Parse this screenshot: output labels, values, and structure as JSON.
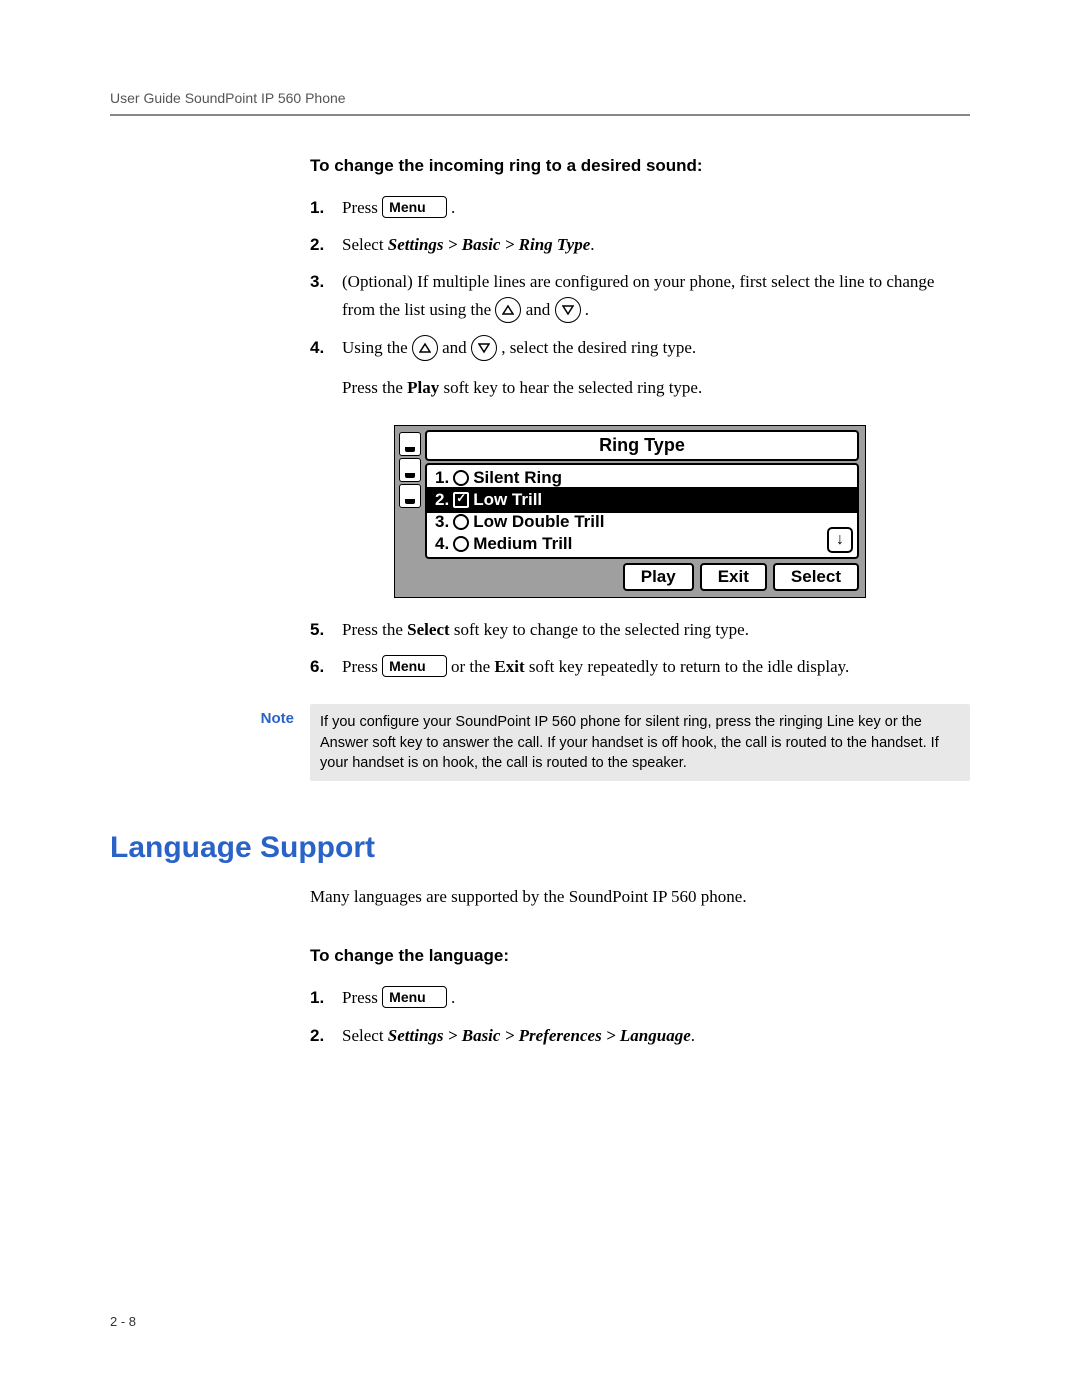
{
  "header": "User Guide SoundPoint IP 560 Phone",
  "section1": {
    "subhead": "To change the incoming ring to a desired sound:",
    "steps": {
      "s1": {
        "num": "1.",
        "press": "Press ",
        "menu": "Menu",
        "after": " ."
      },
      "s2": {
        "num": "2.",
        "select": "Select ",
        "path": "Settings > Basic > Ring Type",
        "after": "."
      },
      "s3": {
        "num": "3.",
        "t1": "(Optional) If multiple lines are configured on your phone, first select the line to change from the list using the ",
        "and": " and ",
        "after": " ."
      },
      "s4": {
        "num": "4.",
        "t1": "Using the ",
        "and": " and ",
        "t2": " , select the desired ring type.",
        "t3": "Press the ",
        "play": "Play",
        "t4": " soft key to hear the selected ring type."
      },
      "s5": {
        "num": "5.",
        "t1": "Press the ",
        "select": "Select",
        "t2": " soft key to change to the selected ring type."
      },
      "s6": {
        "num": "6.",
        "press": "Press ",
        "menu": "Menu",
        "t1": " or the ",
        "exit": "Exit",
        "t2": " soft key repeatedly to return to the idle display."
      }
    }
  },
  "screen": {
    "title": "Ring Type",
    "items": {
      "i1": {
        "num": "1.",
        "label": "Silent Ring",
        "selected": false
      },
      "i2": {
        "num": "2.",
        "label": "Low Trill",
        "selected": true
      },
      "i3": {
        "num": "3.",
        "label": "Low Double Trill",
        "selected": false
      },
      "i4": {
        "num": "4.",
        "label": "Medium Trill",
        "selected": false
      }
    },
    "scroll": "↓",
    "soft": {
      "play": "Play",
      "exit": "Exit",
      "select": "Select"
    }
  },
  "note": {
    "label": "Note",
    "text": "If you configure your SoundPoint IP 560 phone for silent ring, press the ringing Line key or the Answer soft key to answer the call. If your handset is off hook, the call is routed to the handset. If your handset is on hook, the call is routed to the speaker."
  },
  "section2": {
    "heading": "Language Support",
    "intro": "Many languages are supported by the SoundPoint IP 560 phone.",
    "subhead": "To change the language:",
    "steps": {
      "s1": {
        "num": "1.",
        "press": "Press ",
        "menu": "Menu",
        "after": " ."
      },
      "s2": {
        "num": "2.",
        "select": "Select ",
        "path": "Settings > Basic > Preferences > Language",
        "after": "."
      }
    }
  },
  "pageNum": "2 - 8"
}
